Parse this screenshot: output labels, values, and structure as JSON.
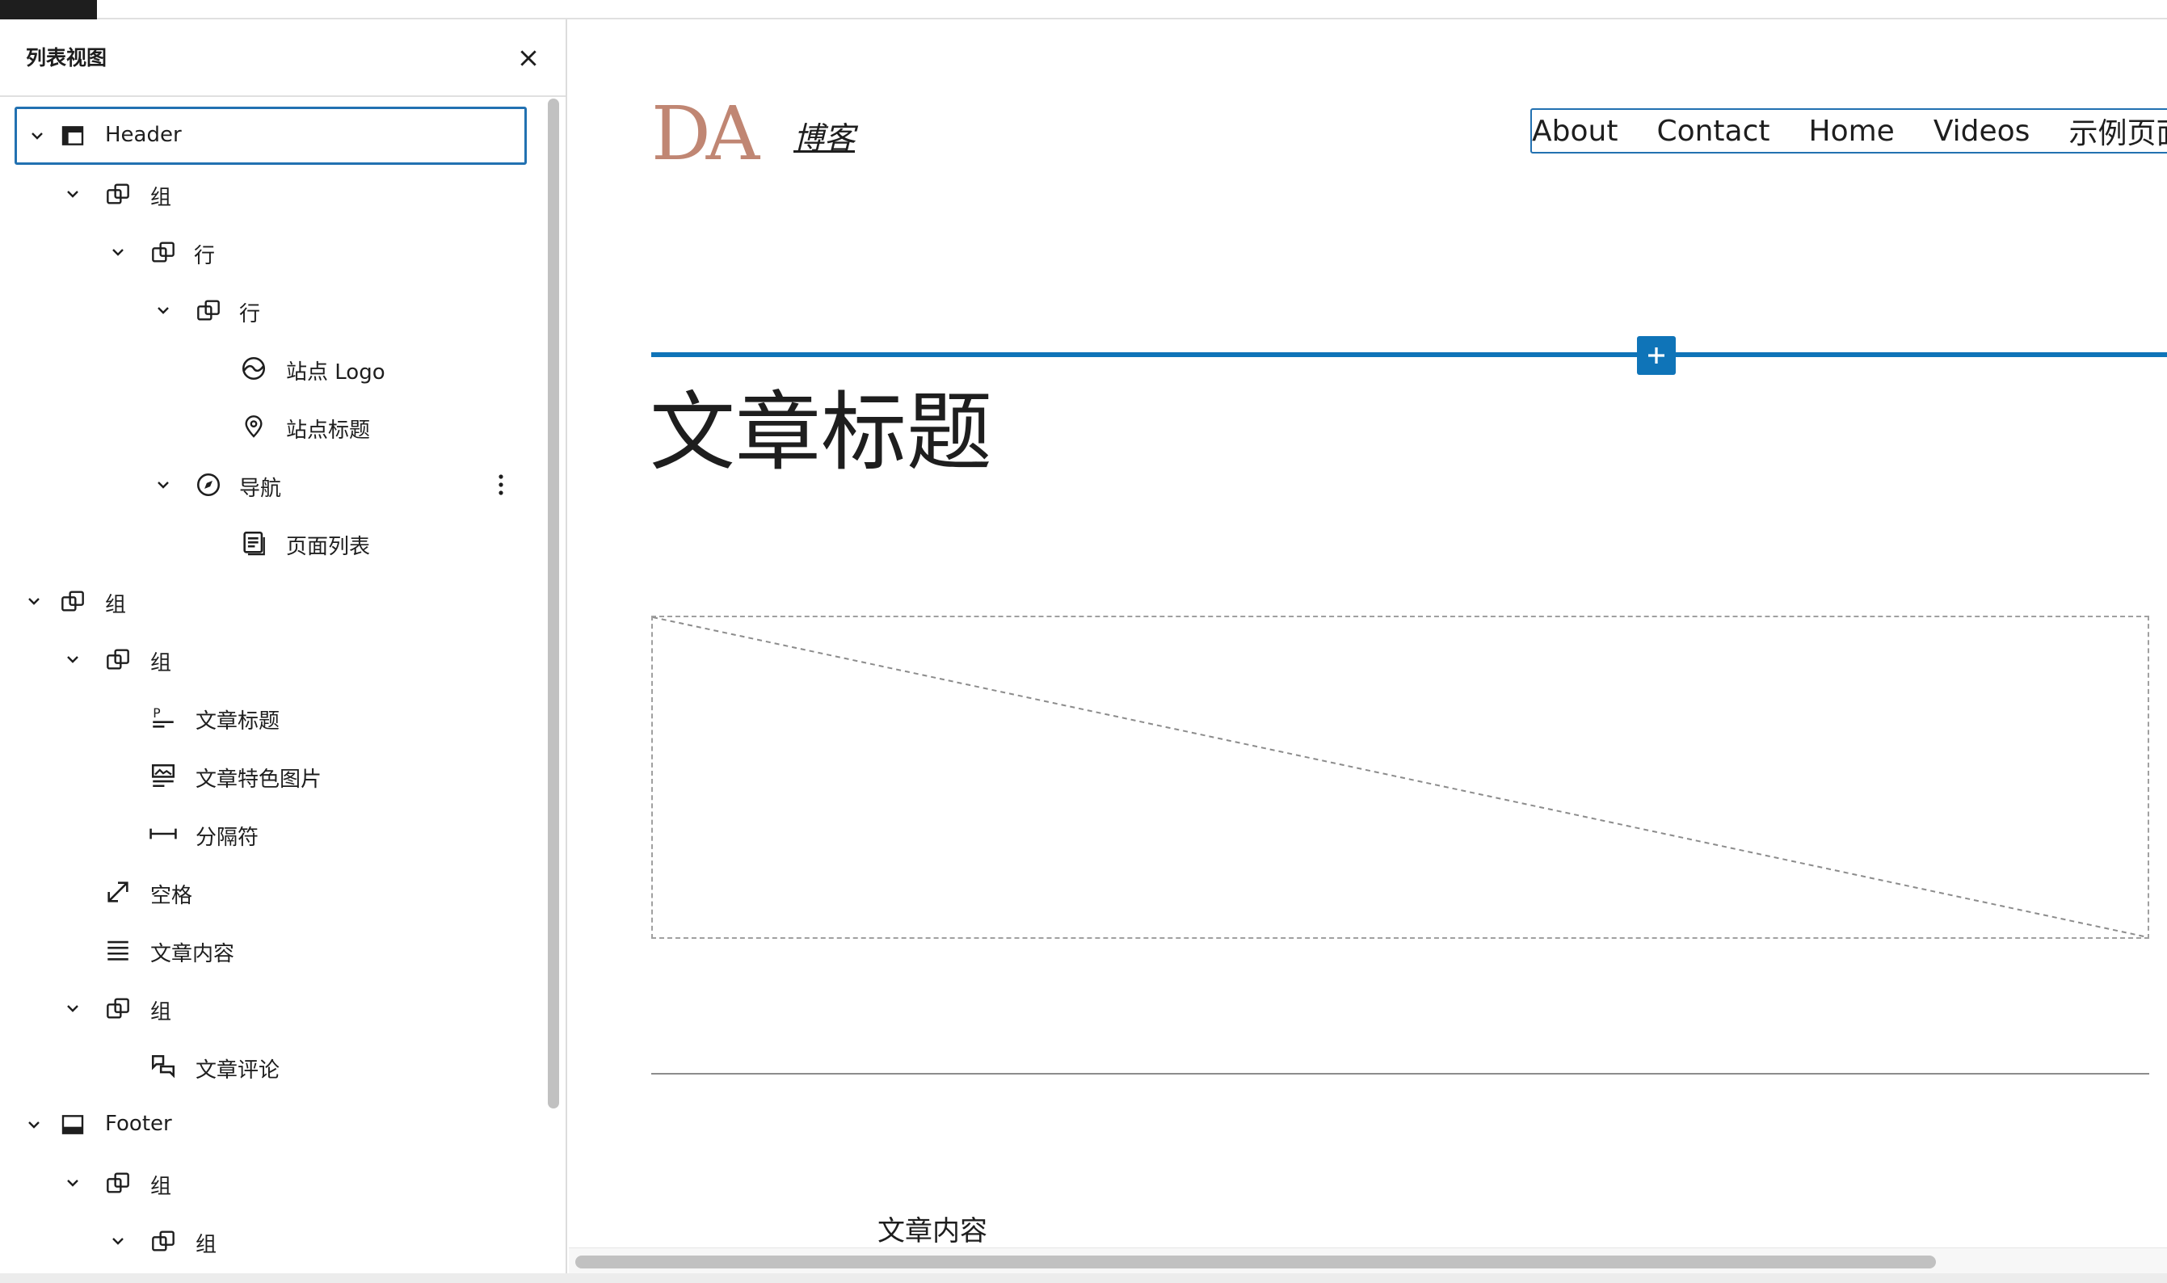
{
  "panel": {
    "title": "列表视图",
    "items": [
      {
        "label": "Header",
        "icon": "template-part-header-icon",
        "expanded": true,
        "selected": true
      },
      {
        "label": "组",
        "icon": "group-icon",
        "expanded": true
      },
      {
        "label": "行",
        "icon": "group-icon",
        "expanded": true
      },
      {
        "label": "行",
        "icon": "group-icon",
        "expanded": true
      },
      {
        "label": "站点 Logo",
        "icon": "site-logo-icon"
      },
      {
        "label": "站点标题",
        "icon": "map-marker-icon"
      },
      {
        "label": "导航",
        "icon": "compass-icon",
        "expanded": true
      },
      {
        "label": "页面列表",
        "icon": "page-list-icon"
      },
      {
        "label": "组",
        "icon": "group-icon",
        "expanded": true
      },
      {
        "label": "组",
        "icon": "group-icon",
        "expanded": true
      },
      {
        "label": "文章标题",
        "icon": "post-title-icon"
      },
      {
        "label": "文章特色图片",
        "icon": "featured-image-icon"
      },
      {
        "label": "分隔符",
        "icon": "separator-icon"
      },
      {
        "label": "空格",
        "icon": "spacer-icon"
      },
      {
        "label": "文章内容",
        "icon": "post-content-icon"
      },
      {
        "label": "组",
        "icon": "group-icon",
        "expanded": true
      },
      {
        "label": "文章评论",
        "icon": "comments-icon"
      },
      {
        "label": "Footer",
        "icon": "template-part-footer-icon",
        "expanded": true
      },
      {
        "label": "组",
        "icon": "group-icon",
        "expanded": true
      },
      {
        "label": "组",
        "icon": "group-icon",
        "expanded": true
      }
    ]
  },
  "canvas": {
    "logo_text": "DA",
    "site_title": "博客",
    "nav_items": [
      "About",
      "Contact",
      "Home",
      "Videos",
      "示例页面"
    ],
    "post_title": "文章标题",
    "post_content": "文章内容"
  },
  "colors": {
    "accent": "#0f74b8",
    "selection": "#2271b1",
    "logo": "#c08673"
  }
}
